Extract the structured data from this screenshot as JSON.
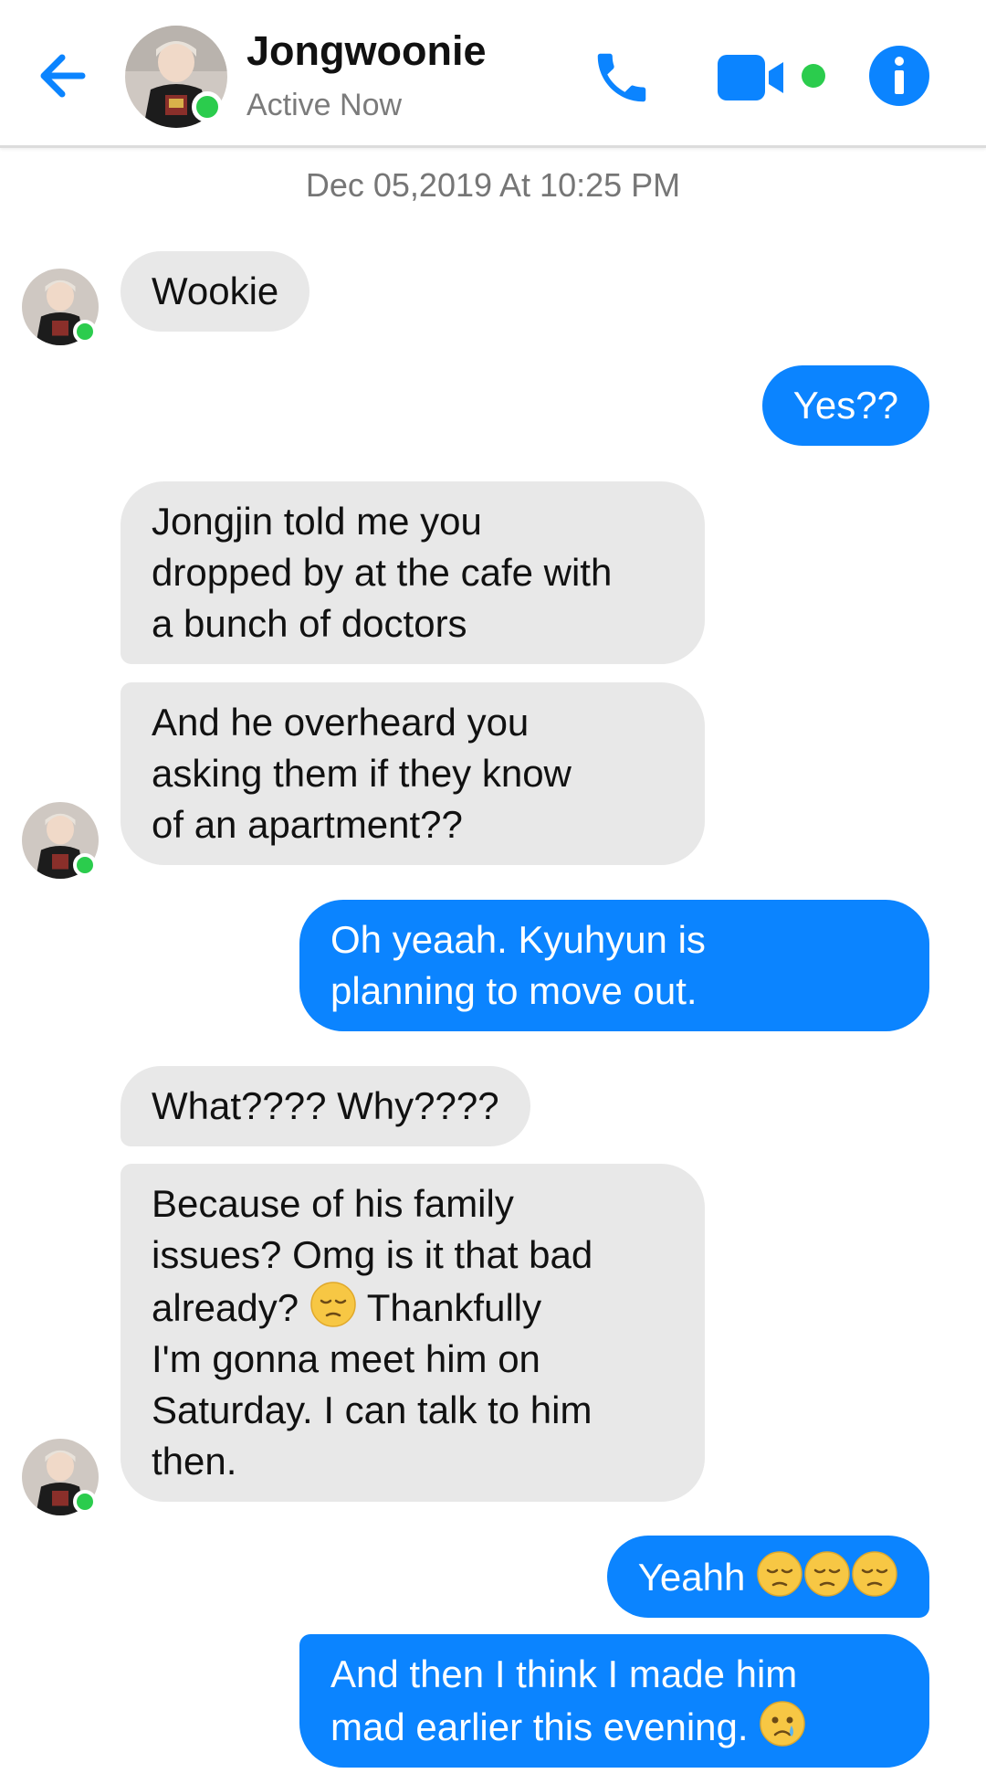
{
  "header": {
    "contact_name": "Jongwoonie",
    "status": "Active Now",
    "accent_color": "#0b84ff",
    "online_color": "#2bcc4d"
  },
  "timestamp": "Dec 05,2019 At 10:25 PM",
  "messages": [
    {
      "from": "them",
      "text": "Wookie"
    },
    {
      "from": "me",
      "text": "Yes??"
    },
    {
      "from": "them",
      "lines": [
        "Jongjin told me you",
        "dropped by at the cafe with",
        "a bunch of doctors"
      ]
    },
    {
      "from": "them",
      "lines": [
        "And he overheard you",
        "asking them if they know",
        "of an apartment??"
      ]
    },
    {
      "from": "me",
      "lines": [
        "Oh yeaah. Kyuhyun is",
        "planning to move out."
      ]
    },
    {
      "from": "them",
      "text": "What???? Why????"
    },
    {
      "from": "them",
      "lines": [
        "Because of his family",
        "issues? Omg is it that bad",
        "already?",
        "Thankfully",
        "I'm gonna meet him on",
        "Saturday. I can talk to him",
        "then."
      ],
      "emoji": "pensive-face"
    },
    {
      "from": "me",
      "text": "Yeahh",
      "emoji": "pensive-face x3"
    },
    {
      "from": "me",
      "lines": [
        "And then I think I made him",
        "mad earlier this evening."
      ],
      "emoji": "crying-face"
    }
  ]
}
